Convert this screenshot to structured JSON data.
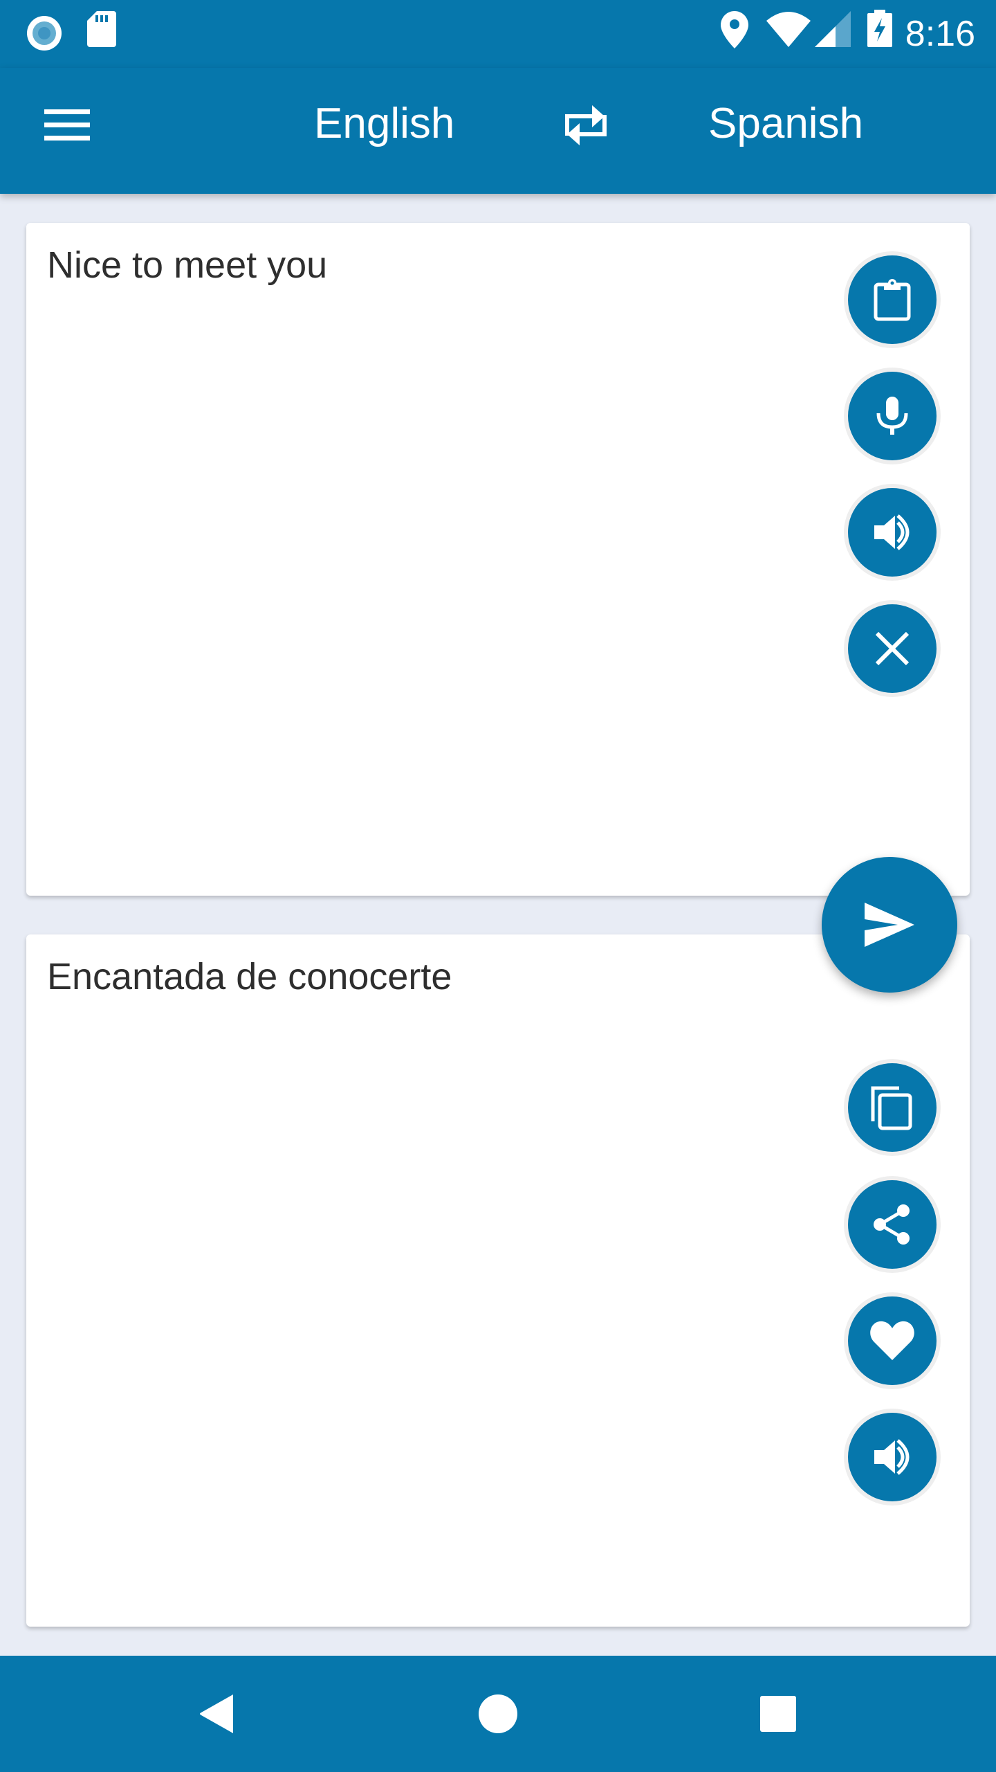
{
  "status_bar": {
    "time": "8:16",
    "left_icons": [
      "record-icon",
      "sd-card-icon"
    ],
    "right_icons": [
      "location-icon",
      "wifi-icon",
      "signal-icon",
      "battery-charging-icon"
    ]
  },
  "app_bar": {
    "menu_icon": "hamburger-menu-icon",
    "source_language": "English",
    "swap_icon": "swap-languages-icon",
    "target_language": "Spanish"
  },
  "source_card": {
    "text": "Nice to meet you",
    "actions": [
      {
        "name": "paste",
        "icon": "clipboard-icon"
      },
      {
        "name": "voice-input",
        "icon": "microphone-icon"
      },
      {
        "name": "speak-source",
        "icon": "speaker-icon"
      },
      {
        "name": "clear",
        "icon": "close-icon"
      }
    ]
  },
  "translate_button": {
    "icon": "send-icon"
  },
  "result_card": {
    "text": "Encantada de conocerte",
    "actions": [
      {
        "name": "copy",
        "icon": "copy-icon"
      },
      {
        "name": "share",
        "icon": "share-icon"
      },
      {
        "name": "favorite",
        "icon": "heart-icon"
      },
      {
        "name": "speak-result",
        "icon": "speaker-icon"
      }
    ]
  },
  "nav_bar": {
    "buttons": [
      "back-icon",
      "home-icon",
      "recents-icon"
    ]
  },
  "colors": {
    "primary": "#0677ac",
    "background": "#e8ecf5",
    "card": "#ffffff",
    "text": "#2e2e2e"
  }
}
